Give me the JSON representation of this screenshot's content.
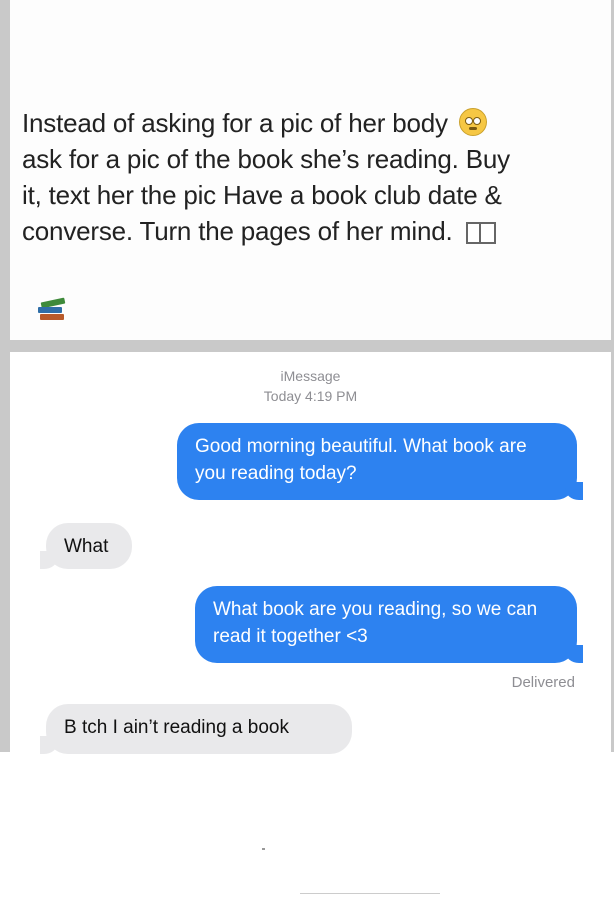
{
  "post": {
    "line1": "Instead of asking for a pic of her body",
    "line2": "ask for a pic of the book she’s reading. Buy",
    "line3": "it, text her the pic Have a book club date &",
    "line4": "converse. Turn the pages of her mind.",
    "emoji_icons": [
      "face-rolling-eyes-icon",
      "open-book-icon",
      "books-stack-icon"
    ]
  },
  "conversation": {
    "service": "iMessage",
    "timestamp": "Today 4:19 PM",
    "messages": [
      {
        "direction": "sent",
        "text": "Good morning beautiful. What book are you reading today?"
      },
      {
        "direction": "received",
        "text": "What"
      },
      {
        "direction": "sent",
        "text": "What book are you reading, so we can read it together <3"
      },
      {
        "direction": "received",
        "text": "B tch I ain’t reading a book"
      }
    ],
    "status": "Delivered"
  },
  "colors": {
    "sent_bubble": "#2d82f0",
    "received_bubble": "#e9e9eb",
    "meta_text": "#8e8e93"
  }
}
